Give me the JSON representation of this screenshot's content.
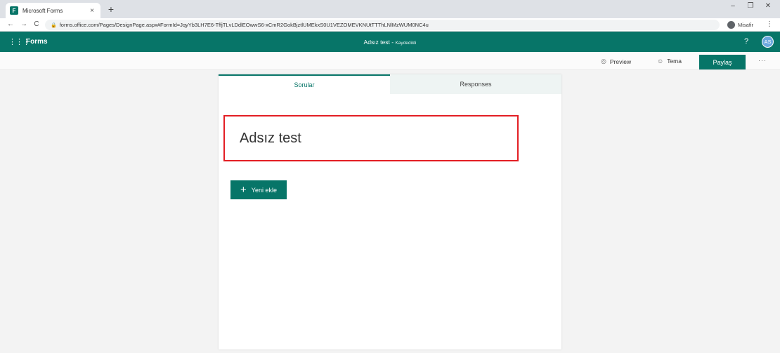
{
  "browser": {
    "tab_title": "Microsoft Forms",
    "tab_close": "×",
    "new_tab": "+",
    "window_controls": {
      "minimize": "–",
      "restore": "❐",
      "close": "✕"
    },
    "nav": {
      "back": "←",
      "forward": "→",
      "reload": "C"
    },
    "url": "forms.office.com/Pages/DesignPage.aspx#FormId=JqyYb3LH7E6-TffjTLvLDdlEOwwS6-xCmR2GokBjztlUMEkxS0U1VEZOMEVKNUtTTThLNlMzWUM0NC4u",
    "profile_label": "Misafir",
    "menu": "⋮"
  },
  "header": {
    "app_name": "Forms",
    "doc_title": "Adsız test",
    "doc_separator": " - ",
    "doc_status": "Kaydedildi",
    "help": "?",
    "avatar_initials": "AS",
    "brand_color": "#077568"
  },
  "commandbar": {
    "preview_label": "Preview",
    "theme_label": "Tema",
    "share_label": "Paylaş",
    "more": "···"
  },
  "form": {
    "tabs": [
      {
        "label": "Sorular",
        "active": true
      },
      {
        "label": "Responses",
        "active": false
      }
    ],
    "title": "Adsız test",
    "add_new_label": "Yeni ekle",
    "highlight_color": "#e31e24"
  }
}
